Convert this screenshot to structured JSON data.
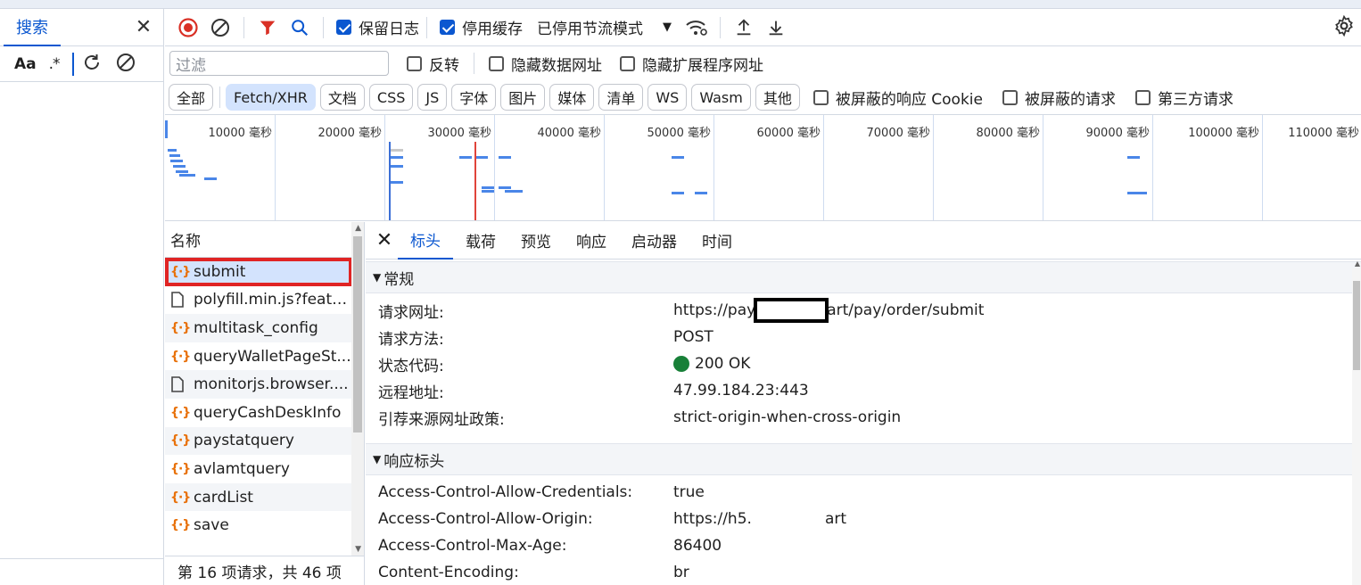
{
  "search_panel": {
    "tab_label": "搜索",
    "match_case_label": "Aa",
    "regex_label": ".*"
  },
  "toolbar": {
    "preserve_log_label": "保留日志",
    "disable_cache_label": "停用缓存",
    "throttle_label": "已停用节流模式"
  },
  "filter_bar": {
    "filter_placeholder": "过滤",
    "invert_label": "反转",
    "hide_data_urls_label": "隐藏数据网址",
    "hide_extension_urls_label": "隐藏扩展程序网址"
  },
  "type_filters": {
    "chips": [
      "全部",
      "Fetch/XHR",
      "文档",
      "CSS",
      "JS",
      "字体",
      "图片",
      "媒体",
      "清单",
      "WS",
      "Wasm",
      "其他"
    ],
    "selected_chip": "Fetch/XHR",
    "blocked_cookies_label": "被屏蔽的响应 Cookie",
    "blocked_requests_label": "被屏蔽的请求",
    "third_party_label": "第三方请求"
  },
  "overview": {
    "tick_labels": [
      "10000 毫秒",
      "20000 毫秒",
      "30000 毫秒",
      "40000 毫秒",
      "50000 毫秒",
      "60000 毫秒",
      "70000 毫秒",
      "80000 毫秒",
      "90000 毫秒",
      "100000 毫秒",
      "110000 毫秒"
    ]
  },
  "request_list": {
    "header": "名称",
    "rows": [
      {
        "name": "submit",
        "type": "fetch",
        "selected": true
      },
      {
        "name": "polyfill.min.js?featu...",
        "type": "doc"
      },
      {
        "name": "multitask_config",
        "type": "fetch"
      },
      {
        "name": "queryWalletPageSt...",
        "type": "fetch"
      },
      {
        "name": "monitorjs.browser....",
        "type": "doc"
      },
      {
        "name": "queryCashDeskInfo",
        "type": "fetch"
      },
      {
        "name": "paystatquery",
        "type": "fetch"
      },
      {
        "name": "avlamtquery",
        "type": "fetch"
      },
      {
        "name": "cardList",
        "type": "fetch"
      },
      {
        "name": "save",
        "type": "fetch"
      }
    ],
    "status": "第 16 项请求，共 46 项"
  },
  "details": {
    "tabs": [
      "标头",
      "载荷",
      "预览",
      "响应",
      "启动器",
      "时间"
    ],
    "active_tab": "标头",
    "general_title": "常规",
    "general": {
      "url_key": "请求网址:",
      "url_prefix": "https://pay",
      "url_suffix": "art/pay/order/submit",
      "method_key": "请求方法:",
      "method_value": "POST",
      "status_key": "状态代码:",
      "status_value": "200 OK",
      "remote_key": "远程地址:",
      "remote_value": "47.99.184.23:443",
      "referrer_key": "引荐来源网址政策:",
      "referrer_value": "strict-origin-when-cross-origin"
    },
    "response_headers_title": "响应标头",
    "response_headers": {
      "h1_key": "Access-Control-Allow-Credentials:",
      "h1_value": "true",
      "h2_key": "Access-Control-Allow-Origin:",
      "h2_value_prefix": "https://h5.",
      "h2_value_suffix": "art",
      "h3_key": "Access-Control-Max-Age:",
      "h3_value": "86400",
      "h4_key": "Content-Encoding:",
      "h4_value": "br"
    }
  },
  "colors": {
    "accent": "#0b57d0",
    "selection": "#d3e3fd",
    "highlight_box": "#e02424",
    "fetch_icon": "#e8710a",
    "status_ok": "#188038"
  }
}
